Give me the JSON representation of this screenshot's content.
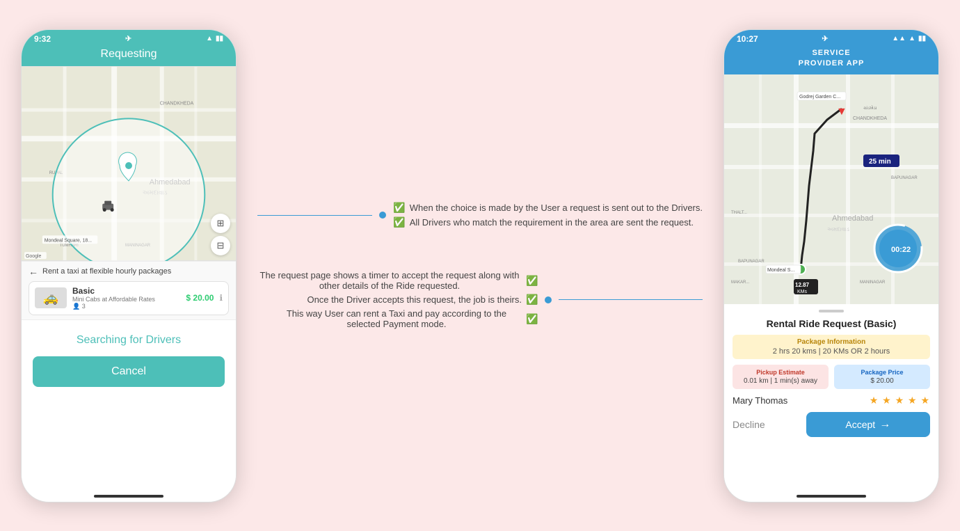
{
  "bg_color": "#fce8e8",
  "phone1": {
    "status": {
      "time": "9:32",
      "time_icon": "📍",
      "wifi": "wifi",
      "battery": "battery"
    },
    "header": "Requesting",
    "map": {
      "label": "Google"
    },
    "taxi_section": {
      "back_text": "Rent a taxi at flexible hourly packages",
      "card": {
        "name": "Basic",
        "desc": "Mini Cabs at Affordable Rates",
        "rating": "3",
        "price": "$ 20.00"
      }
    },
    "bottom": {
      "searching_text": "Searching for Drivers",
      "cancel_label": "Cancel"
    }
  },
  "phone2": {
    "status": {
      "time": "10:27",
      "time_icon": "📍"
    },
    "header_line1": "SERVICE",
    "header_line2": "PROVIDER APP",
    "map": {
      "origin_label": "Mondeal S...",
      "dest_label": "Godrej Garden C...",
      "time_badge": "25 min",
      "distance": "12.87\nKMs",
      "timer": "00:22"
    },
    "card": {
      "drag": "",
      "title": "Rental Ride Request (Basic)",
      "pkg_label": "Package Information",
      "pkg_value": "2 hrs 20 kms  |  20 KMs OR 2 hours",
      "pickup_label": "Pickup Estimate",
      "pickup_value": "0.01 km  |  1 min(s) away",
      "price_label": "Package Price",
      "price_value": "$ 20.00",
      "user_name": "Mary Thomas",
      "stars": "★ ★ ★ ★ ★",
      "decline_label": "Decline",
      "accept_label": "Accept"
    }
  },
  "annotations": {
    "top": {
      "line1": "When the choice is made by the User a request is sent out to the Drivers.",
      "line2": "All Drivers who match the requirement in the area are sent the request."
    },
    "bottom": {
      "line1": "The request page shows a timer to accept the request along with other details of the Ride requested.",
      "line2": "Once the Driver accepts this request, the job is theirs.",
      "line3": "This way User can rent a Taxi and pay according to the selected Payment mode."
    }
  }
}
